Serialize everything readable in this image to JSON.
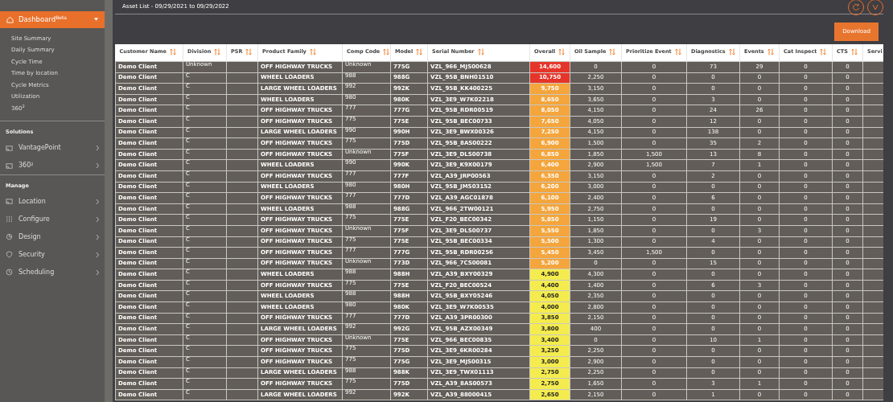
{
  "sidebar": {
    "nav": [
      {
        "label": "Dashboard$^{Beta}$",
        "selected": true,
        "expanded": true,
        "children": [
          {
            "label": "Site Summary"
          },
          {
            "label": "Daily Summary"
          },
          {
            "label": "Cycle Time"
          },
          {
            "label": "Time by location"
          },
          {
            "label": "Cycle Metrics"
          },
          {
            "label": "Utilization"
          },
          {
            "label": "360$^{2}$"
          }
        ]
      }
    ],
    "sections": [
      {
        "title": "Solutions",
        "items": [
          {
            "label": "VantagePoint",
            "expanded": false
          },
          {
            "label": "360$^{2}$",
            "expanded": false
          }
        ]
      },
      {
        "title": "Manage",
        "items": [
          {
            "label": "Location",
            "expanded": false
          },
          {
            "label": "Configure",
            "expanded": false
          },
          {
            "label": "Design",
            "expanded": false
          },
          {
            "label": "Security",
            "expanded": false
          },
          {
            "label": "Scheduling",
            "expanded": false
          }
        ]
      }
    ]
  },
  "header": {
    "title": "Asset List - 09/29/2021 to 09/29/2022"
  },
  "download_button": {
    "label": "Download"
  },
  "table": {
    "columns": [
      {
        "label": "Customer Name",
        "kind": "bold",
        "sortable": true
      },
      {
        "label": "Division",
        "kind": "plain",
        "sortable": true
      },
      {
        "label": "PSR",
        "kind": "blank",
        "sortable": true
      },
      {
        "label": "Product Family",
        "kind": "bold",
        "sortable": true
      },
      {
        "label": "Comp Code",
        "kind": "plain",
        "sortable": true
      },
      {
        "label": "Model",
        "kind": "bold",
        "sortable": true
      },
      {
        "label": "Serial Number",
        "kind": "bold",
        "sortable": true
      },
      {
        "label": "Overall",
        "kind": "score",
        "sortable": true
      },
      {
        "label": "Oil Sample",
        "kind": "number",
        "sortable": true
      },
      {
        "label": "Prioritize Event",
        "kind": "number",
        "sortable": true
      },
      {
        "label": "Diagnostics",
        "kind": "number",
        "sortable": true
      },
      {
        "label": "Events",
        "kind": "number",
        "sortable": true
      },
      {
        "label": "Cat Inspect",
        "kind": "number",
        "sortable": true
      },
      {
        "label": "CTS",
        "kind": "number",
        "sortable": true
      },
      {
        "label": "Servi",
        "kind": "blank",
        "sortable": false
      }
    ],
    "rows": [
      {
        "cells": [
          "Demo Client",
          "Unknown",
          "",
          "OFF HIGHWAY TRUCKS",
          "Unknown",
          "775G",
          "VZL_966_MJS00628",
          "14,600",
          "0",
          "0",
          "73",
          "29",
          "0",
          "0",
          ""
        ],
        "color": "#e5352a"
      },
      {
        "cells": [
          "Demo Client",
          "C",
          "",
          "WHEEL LOADERS",
          "988",
          "988G",
          "VZL_95B_BNH01510",
          "10,750",
          "2,250",
          "0",
          "0",
          "0",
          "0",
          "0",
          ""
        ],
        "color": "#e5352a"
      },
      {
        "cells": [
          "Demo Client",
          "C",
          "",
          "LARGE WHEEL LOADERS",
          "992",
          "992K",
          "VZL_95B_KK400225",
          "9,750",
          "3,150",
          "0",
          "0",
          "0",
          "0",
          "0",
          ""
        ],
        "color": "#f4a53c"
      },
      {
        "cells": [
          "Demo Client",
          "C",
          "",
          "WHEEL LOADERS",
          "980",
          "980K",
          "VZL_3E9_W7K02218",
          "8,650",
          "3,650",
          "0",
          "3",
          "0",
          "0",
          "0",
          ""
        ],
        "color": "#f4a53c"
      },
      {
        "cells": [
          "Demo Client",
          "C",
          "",
          "OFF HIGHWAY TRUCKS",
          "777",
          "777G",
          "VZL_95B_RDR00519",
          "8,050",
          "4,150",
          "0",
          "24",
          "26",
          "0",
          "0",
          ""
        ],
        "color": "#f4a53c"
      },
      {
        "cells": [
          "Demo Client",
          "C",
          "",
          "OFF HIGHWAY TRUCKS",
          "775",
          "775E",
          "VZL_95B_BEC00733",
          "7,650",
          "4,050",
          "0",
          "12",
          "0",
          "0",
          "0",
          ""
        ],
        "color": "#f4a53c"
      },
      {
        "cells": [
          "Demo Client",
          "C",
          "",
          "LARGE WHEEL LOADERS",
          "990",
          "990H",
          "VZL_3E9_BWX00326",
          "7,250",
          "4,150",
          "0",
          "138",
          "0",
          "0",
          "0",
          ""
        ],
        "color": "#f4a53c"
      },
      {
        "cells": [
          "Demo Client",
          "C",
          "",
          "OFF HIGHWAY TRUCKS",
          "775",
          "775D",
          "VZL_95B_8AS00222",
          "6,900",
          "1,500",
          "0",
          "35",
          "2",
          "0",
          "0",
          ""
        ],
        "color": "#f4a53c"
      },
      {
        "cells": [
          "Demo Client",
          "C",
          "",
          "OFF HIGHWAY TRUCKS",
          "Unknown",
          "775F",
          "VZL_3E9_DLS00738",
          "6,850",
          "1,850",
          "1,500",
          "13",
          "8",
          "0",
          "0",
          ""
        ],
        "color": "#f4a53c"
      },
      {
        "cells": [
          "Demo Client",
          "C",
          "",
          "WHEEL LOADERS",
          "990",
          "990K",
          "VZL_3E9_K9X00179",
          "6,400",
          "2,900",
          "1,500",
          "7",
          "1",
          "0",
          "0",
          ""
        ],
        "color": "#f4a53c"
      },
      {
        "cells": [
          "Demo Client",
          "C",
          "",
          "OFF HIGHWAY TRUCKS",
          "777",
          "777F",
          "VZL_A39_JRP00563",
          "6,350",
          "3,150",
          "0",
          "2",
          "0",
          "0",
          "0",
          ""
        ],
        "color": "#f4a53c"
      },
      {
        "cells": [
          "Demo Client",
          "C",
          "",
          "WHEEL LOADERS",
          "980",
          "980H",
          "VZL_95B_JMS03152",
          "6,200",
          "3,000",
          "0",
          "0",
          "0",
          "0",
          "0",
          ""
        ],
        "color": "#f4a53c"
      },
      {
        "cells": [
          "Demo Client",
          "C",
          "",
          "OFF HIGHWAY TRUCKS",
          "777",
          "777D",
          "VZL_A39_AGC01878",
          "6,100",
          "2,400",
          "0",
          "6",
          "0",
          "0",
          "0",
          ""
        ],
        "color": "#f4a53c"
      },
      {
        "cells": [
          "Demo Client",
          "C",
          "",
          "WHEEL LOADERS",
          "988",
          "988G",
          "VZL_966_2TW00121",
          "5,950",
          "2,750",
          "0",
          "0",
          "0",
          "0",
          "0",
          ""
        ],
        "color": "#f4a53c"
      },
      {
        "cells": [
          "Demo Client",
          "C",
          "",
          "OFF HIGHWAY TRUCKS",
          "775",
          "775E",
          "VZL_F20_BEC00342",
          "5,850",
          "1,150",
          "0",
          "19",
          "0",
          "0",
          "0",
          ""
        ],
        "color": "#f4a53c"
      },
      {
        "cells": [
          "Demo Client",
          "C",
          "",
          "OFF HIGHWAY TRUCKS",
          "Unknown",
          "775F",
          "VZL_3E9_DLS00737",
          "5,550",
          "1,850",
          "0",
          "0",
          "3",
          "0",
          "0",
          ""
        ],
        "color": "#f4a53c"
      },
      {
        "cells": [
          "Demo Client",
          "C",
          "",
          "OFF HIGHWAY TRUCKS",
          "775",
          "775E",
          "VZL_95B_BEC00334",
          "5,500",
          "1,300",
          "0",
          "4",
          "0",
          "0",
          "0",
          ""
        ],
        "color": "#f4a53c"
      },
      {
        "cells": [
          "Demo Client",
          "C",
          "",
          "OFF HIGHWAY TRUCKS",
          "777",
          "777G",
          "VZL_95B_RDR00256",
          "5,450",
          "3,450",
          "1,500",
          "0",
          "0",
          "0",
          "0",
          ""
        ],
        "color": "#f4a53c"
      },
      {
        "cells": [
          "Demo Client",
          "C",
          "",
          "OFF HIGHWAY TRUCKS",
          "Unknown",
          "773D",
          "VZL_966_7CS00081",
          "5,200",
          "0",
          "0",
          "15",
          "0",
          "0",
          "0",
          ""
        ],
        "color": "#f4a53c"
      },
      {
        "cells": [
          "Demo Client",
          "C",
          "",
          "WHEEL LOADERS",
          "988",
          "988H",
          "VZL_A39_BXY00329",
          "4,900",
          "4,300",
          "0",
          "0",
          "0",
          "0",
          "0",
          ""
        ],
        "color": "#f4ec4e"
      },
      {
        "cells": [
          "Demo Client",
          "C",
          "",
          "OFF HIGHWAY TRUCKS",
          "775",
          "775E",
          "VZL_F20_BEC00524",
          "4,400",
          "1,400",
          "0",
          "6",
          "3",
          "0",
          "0",
          ""
        ],
        "color": "#f4ec4e"
      },
      {
        "cells": [
          "Demo Client",
          "C",
          "",
          "WHEEL LOADERS",
          "988",
          "988H",
          "VZL_95B_BXY05246",
          "4,050",
          "2,350",
          "0",
          "0",
          "0",
          "0",
          "0",
          ""
        ],
        "color": "#f4ec4e"
      },
      {
        "cells": [
          "Demo Client",
          "C",
          "",
          "WHEEL LOADERS",
          "980",
          "980K",
          "VZL_3E9_W7K00535",
          "4,000",
          "2,800",
          "0",
          "0",
          "0",
          "0",
          "0",
          ""
        ],
        "color": "#f4ec4e"
      },
      {
        "cells": [
          "Demo Client",
          "C",
          "",
          "OFF HIGHWAY TRUCKS",
          "777",
          "777D",
          "VZL_A39_3PR00300",
          "3,850",
          "2,150",
          "0",
          "0",
          "0",
          "0",
          "0",
          ""
        ],
        "color": "#f4ec4e"
      },
      {
        "cells": [
          "Demo Client",
          "C",
          "",
          "LARGE WHEEL LOADERS",
          "992",
          "992G",
          "VZL_95B_AZX00349",
          "3,800",
          "400",
          "0",
          "0",
          "0",
          "0",
          "0",
          ""
        ],
        "color": "#f4ec4e"
      },
      {
        "cells": [
          "Demo Client",
          "C",
          "",
          "OFF HIGHWAY TRUCKS",
          "Unknown",
          "775E",
          "VZL_966_BEC00835",
          "3,400",
          "0",
          "0",
          "10",
          "1",
          "0",
          "0",
          ""
        ],
        "color": "#f4ec4e"
      },
      {
        "cells": [
          "Demo Client",
          "C",
          "",
          "OFF HIGHWAY TRUCKS",
          "775",
          "775D",
          "VZL_3E9_6KR00284",
          "3,250",
          "2,250",
          "0",
          "0",
          "0",
          "0",
          "0",
          ""
        ],
        "color": "#f4ec4e"
      },
      {
        "cells": [
          "Demo Client",
          "C",
          "",
          "OFF HIGHWAY TRUCKS",
          "775",
          "775G",
          "VZL_3E9_MJS00315",
          "3,000",
          "2,900",
          "0",
          "0",
          "0",
          "0",
          "0",
          ""
        ],
        "color": "#f4ec4e"
      },
      {
        "cells": [
          "Demo Client",
          "C",
          "",
          "LARGE WHEEL LOADERS",
          "988",
          "988K",
          "VZL_3E9_TWX01113",
          "2,750",
          "2,250",
          "0",
          "0",
          "0",
          "0",
          "0",
          ""
        ],
        "color": "#f4ec4e"
      },
      {
        "cells": [
          "Demo Client",
          "C",
          "",
          "OFF HIGHWAY TRUCKS",
          "775",
          "775D",
          "VZL_A39_8AS00573",
          "2,750",
          "1,650",
          "0",
          "3",
          "1",
          "0",
          "0",
          ""
        ],
        "color": "#f4ec4e"
      },
      {
        "cells": [
          "Demo Client",
          "C",
          "",
          "LARGE WHEEL LOADERS",
          "992",
          "992K",
          "VZL_A39_88000415",
          "2,650",
          "2,150",
          "0",
          "1",
          "0",
          "0",
          "0",
          ""
        ],
        "color": "#f4ec4e"
      }
    ]
  }
}
